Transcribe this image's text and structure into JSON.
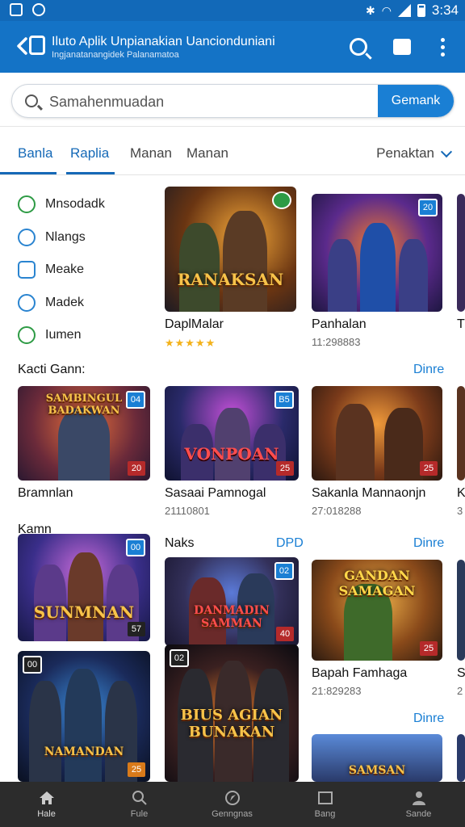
{
  "status": {
    "time": "3:34"
  },
  "appbar": {
    "title": "Iluto Aplik  Unpianakian Uancionduniani",
    "subtitle": "Ingjanatanangidek Palanamatoa"
  },
  "search": {
    "placeholder": "Samahenmuadan",
    "button": "Gemank"
  },
  "tabs": {
    "items": [
      "Banla",
      "Raplia",
      "Manan",
      "Manan"
    ],
    "sort": "Penaktan"
  },
  "categories": [
    "Mnsodadk",
    "Nlangs",
    "Meake",
    "Madek",
    "Iumen"
  ],
  "sections": {
    "s1": "Kacti Gann:",
    "s2": "Kamn",
    "s3": "Naks",
    "more": "Dinre",
    "dpd": "DPD"
  },
  "cards": {
    "a": {
      "name": "DaplMalar",
      "stars": "★★★★★",
      "art": "RANAKSAN"
    },
    "b": {
      "name": "Panhalan",
      "meta": "11:298883",
      "badge": "20"
    },
    "c": {
      "name": "Tr"
    },
    "d": {
      "name": "Bramnlan",
      "art": "SAMBINGUL BADAKWAN",
      "badge": "04",
      "badge2": "20"
    },
    "e": {
      "name": "Sasaai Pamnogal",
      "meta": "21110801",
      "art": "VONPOAN",
      "badge": "B5",
      "badge2": "25"
    },
    "f": {
      "name": "Sakanla Mannaonjn",
      "meta": "27:018288",
      "badge2": "25"
    },
    "g": {
      "name": "K",
      "meta": "3"
    },
    "h": {
      "art": "SUNMNAN",
      "badge": "00",
      "badge2": "57"
    },
    "i": {
      "art": "DANMADIN SAMMAN",
      "badge": "02",
      "badge2": "40"
    },
    "j": {
      "name": "Bapah Famhaga",
      "meta": "21:829283",
      "art": "GANDAN SAMAGAN",
      "badge2": "25"
    },
    "k": {
      "name": "S",
      "meta": "2"
    },
    "l": {
      "art": "NAMANDAN",
      "badge": "00",
      "badge2": "25"
    },
    "m": {
      "art": "BIUS AGIAN BUNAKAN",
      "badge": "02"
    },
    "n": {
      "art": "SAMSAN"
    }
  },
  "more2": "Dinre",
  "nav": [
    "Hale",
    "Fule",
    "Genngnas",
    "Bang",
    "Sande"
  ]
}
